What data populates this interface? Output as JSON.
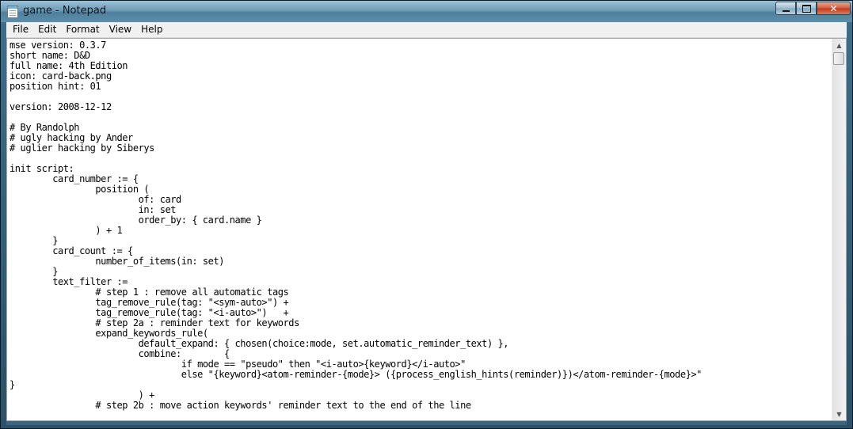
{
  "window": {
    "title": "game - Notepad"
  },
  "controls": {
    "minimize": "minimize",
    "maximize": "maximize",
    "close": "✕"
  },
  "menu": [
    "File",
    "Edit",
    "Format",
    "View",
    "Help"
  ],
  "editor": {
    "lines": [
      "mse version: 0.3.7",
      "short name: D&D",
      "full name: 4th Edition",
      "icon: card-back.png",
      "position hint: 01",
      "",
      "version: 2008-12-12",
      "",
      "# By Randolph",
      "# ugly hacking by Ander",
      "# uglier hacking by Siberys",
      "",
      "init script:",
      "\tcard_number := {",
      "\t\tposition (",
      "\t\t\tof: card",
      "\t\t\tin: set",
      "\t\t\torder_by: { card.name }",
      "\t\t) + 1",
      "\t}",
      "\tcard_count := {",
      "\t\tnumber_of_items(in: set)",
      "\t}",
      "\ttext_filter :=",
      "\t\t# step 1 : remove all automatic tags",
      "\t\ttag_remove_rule(tag: \"<sym-auto>\") +",
      "\t\ttag_remove_rule(tag: \"<i-auto>\")   +",
      "\t\t# step 2a : reminder text for keywords",
      "\t\texpand_keywords_rule(",
      "\t\t\tdefault_expand: { chosen(choice:mode, set.automatic_reminder_text) },",
      "\t\t\tcombine:        {",
      "\t\t\t\tif mode == \"pseudo\" then \"<i-auto>{keyword}</i-auto>\"",
      "\t\t\t\telse \"{keyword}<atom-reminder-{mode}> ({process_english_hints(reminder)})</atom-reminder-{mode}>\"",
      "}",
      "\t\t\t) +",
      "\t\t# step 2b : move action keywords' reminder text to the end of the line"
    ]
  },
  "colors": {
    "titlebar": "#6f9bb5",
    "close": "#c0391c",
    "editor_bg": "#ffffff"
  }
}
